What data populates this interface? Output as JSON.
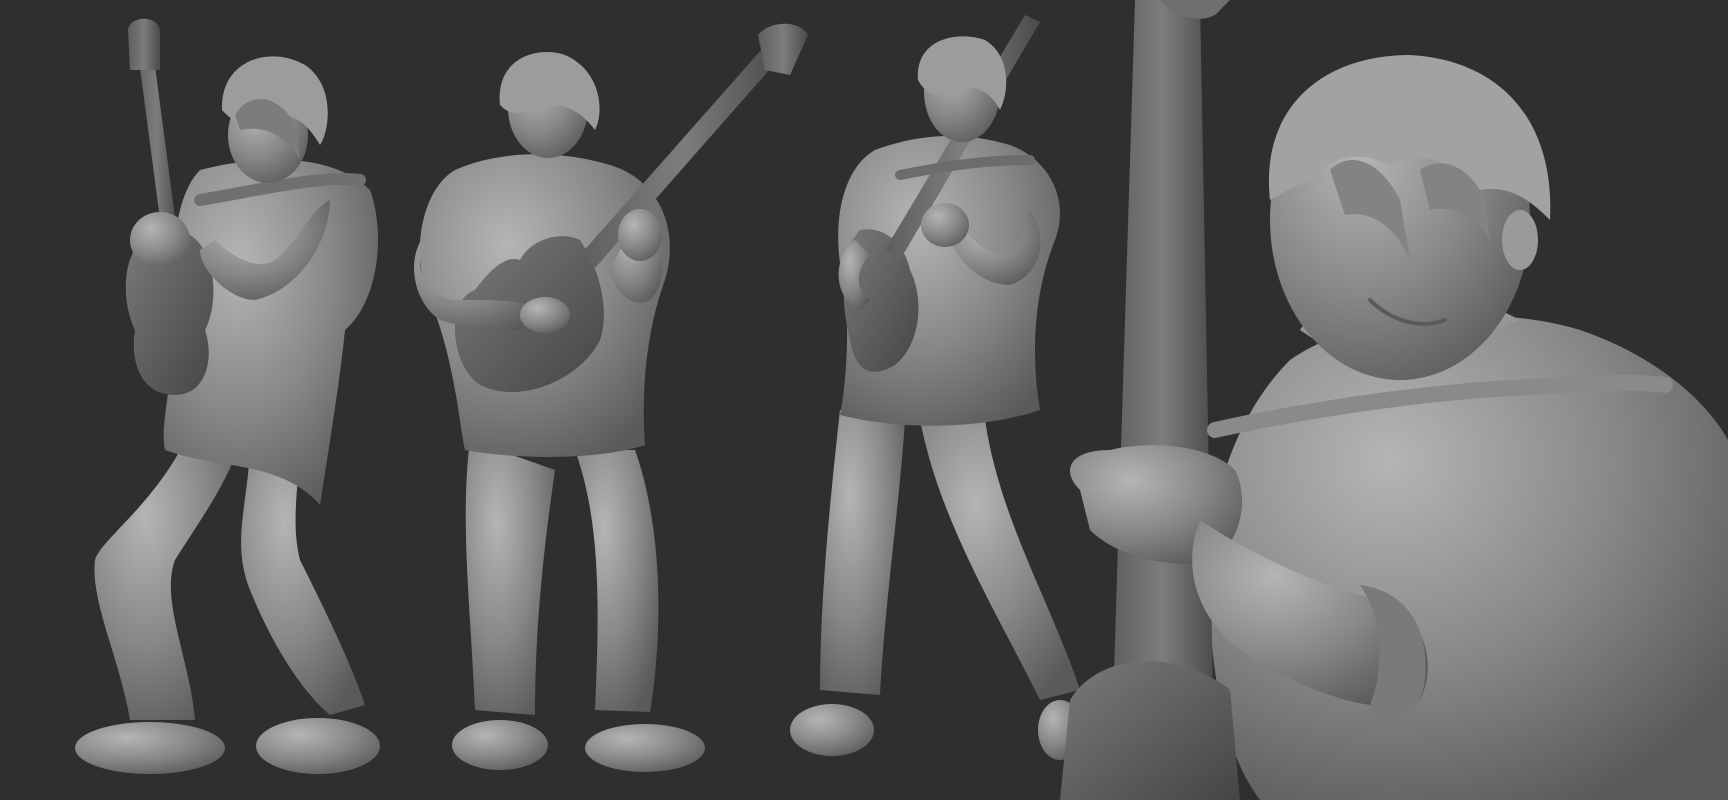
{
  "scene": {
    "background_color": "#2f2f2f",
    "material_color": "#8a8a8a",
    "figures": [
      {
        "view": "three-quarter-left",
        "subject": "guitarist"
      },
      {
        "view": "front",
        "subject": "guitarist"
      },
      {
        "view": "three-quarter-right",
        "subject": "guitarist"
      },
      {
        "view": "close-up",
        "subject": "guitarist"
      }
    ]
  }
}
